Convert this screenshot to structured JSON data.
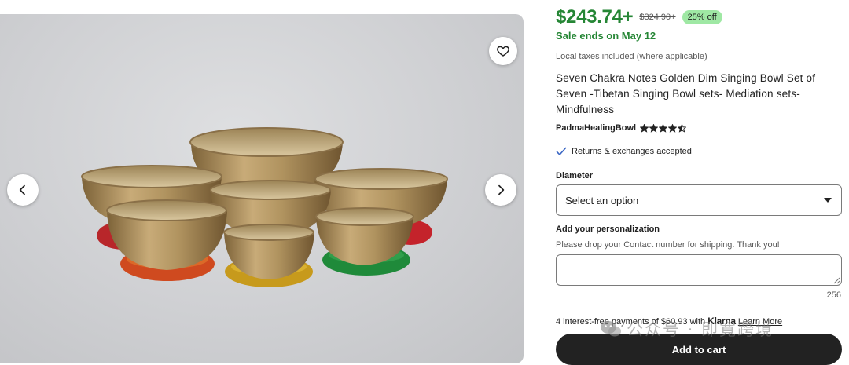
{
  "listing": {
    "price": "$243.74+",
    "original_price": "$324.90+",
    "discount": "25% off",
    "sale_ends": "Sale ends on May 12",
    "taxes_note": "Local taxes included (where applicable)",
    "title": "Seven Chakra Notes Golden Dim Singing Bowl Set of Seven -Tibetan Singing Bowl sets- Mediation sets- Mindfulness",
    "shop_name": "PadmaHealingBowl",
    "rating": 4.5,
    "returns_text": "Returns & exchanges accepted"
  },
  "options": {
    "diameter_label": "Diameter",
    "diameter_select_value": "Select an option",
    "personalization_label": "Add your personalization",
    "personalization_hint": "Please drop your Contact number for shipping. Thank you!",
    "personalization_value": "",
    "char_limit": "256"
  },
  "payment": {
    "klarna_prefix": "4 interest-free payments of $60.93 with",
    "klarna_brand": "Klarna",
    "learn_more": "Learn More",
    "add_to_cart": "Add to cart"
  },
  "watermark": {
    "text": "公众号 · 即寬跨境",
    "icon": "wechat-icon"
  },
  "icons": {
    "favorite": "heart-icon",
    "prev": "chevron-left-icon",
    "next": "chevron-right-icon",
    "select_arrow": "caret-down-icon",
    "returns": "checkmark-icon"
  },
  "colors": {
    "price_green": "#258635",
    "badge_green": "#9fe8a4",
    "button_dark": "#222222",
    "returns_check": "#3b67c4",
    "star": "#222222"
  }
}
